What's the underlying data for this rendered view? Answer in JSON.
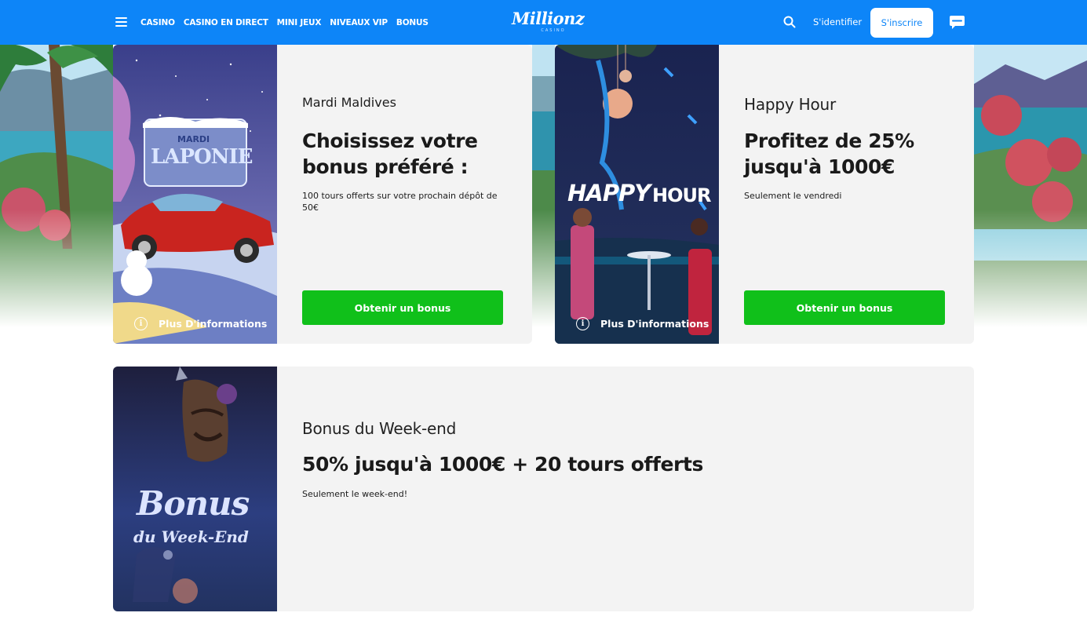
{
  "header": {
    "nav": [
      "CASINO",
      "CASINO EN DIRECT",
      "MINI JEUX",
      "NIVEAUX VIP",
      "BONUS"
    ],
    "logo_text": "Millionz",
    "logo_sub": "CASINO",
    "login_label": "S'identifier",
    "signup_label": "S'inscrire",
    "brand_color": "#0d85f8"
  },
  "promos": [
    {
      "image_title_top": "MARDI",
      "image_title_main": "LAPONIE",
      "label": "Mardi Maldives",
      "title_line1": "Choisissez votre",
      "title_line2": "bonus préféré :",
      "description_line1": "100 tours offerts sur votre prochain dépôt de",
      "description_line2": "50€",
      "button_label": "Obtenir un bonus",
      "more_info_label": "Plus D'informations"
    },
    {
      "image_title_a": "HAPPY",
      "image_title_b": "HOUR",
      "label": "Happy Hour",
      "title_line1": "Profitez de 25%",
      "title_line2": "jusqu'à 1000€",
      "description": "Seulement le vendredi",
      "button_label": "Obtenir un bonus",
      "more_info_label": "Plus D'informations"
    },
    {
      "image_title_a": "Bonus",
      "image_title_b": "du Week-End",
      "label": "Bonus du Week-end",
      "title": "50% jusqu'à 1000€ + 20 tours offerts",
      "description": "Seulement le week-end!"
    }
  ],
  "colors": {
    "button_green": "#10c01a",
    "card_bg": "#f3f3f3"
  }
}
